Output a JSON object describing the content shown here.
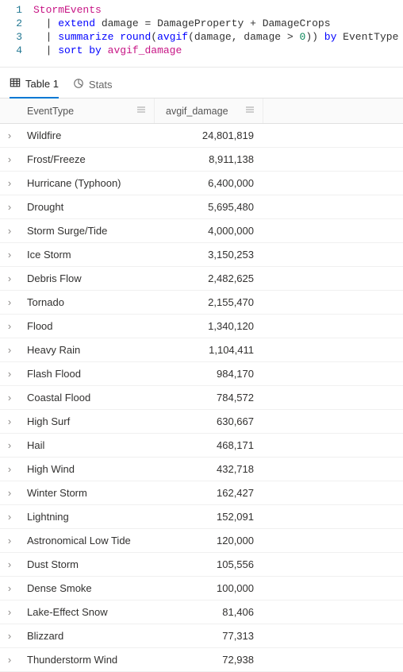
{
  "editor": {
    "lines": [
      {
        "n": "1",
        "tokens": [
          [
            "t-col",
            "StormEvents"
          ]
        ]
      },
      {
        "n": "2",
        "tokens": [
          [
            "t-pipe",
            "  | "
          ],
          [
            "t-kw",
            "extend"
          ],
          [
            "t-id",
            " damage "
          ],
          [
            "t-op",
            "="
          ],
          [
            "t-id",
            " DamageProperty "
          ],
          [
            "t-op",
            "+"
          ],
          [
            "t-id",
            " DamageCrops"
          ]
        ]
      },
      {
        "n": "3",
        "tokens": [
          [
            "t-pipe",
            "  | "
          ],
          [
            "t-kw",
            "summarize"
          ],
          [
            "t-id",
            " "
          ],
          [
            "t-fn",
            "round"
          ],
          [
            "t-id",
            "("
          ],
          [
            "t-fn",
            "avgif"
          ],
          [
            "t-id",
            "(damage, damage "
          ],
          [
            "t-op",
            ">"
          ],
          [
            "t-id",
            " "
          ],
          [
            "t-num",
            "0"
          ],
          [
            "t-id",
            ")) "
          ],
          [
            "t-byk",
            "by"
          ],
          [
            "t-id",
            " EventType"
          ]
        ]
      },
      {
        "n": "4",
        "tokens": [
          [
            "t-pipe",
            "  | "
          ],
          [
            "t-kw",
            "sort"
          ],
          [
            "t-id",
            " "
          ],
          [
            "t-byk",
            "by"
          ],
          [
            "t-id",
            " "
          ],
          [
            "t-col",
            "avgif_damage"
          ]
        ]
      }
    ]
  },
  "tabs": {
    "table_label": "Table 1",
    "stats_label": "Stats"
  },
  "table": {
    "columns": [
      "EventType",
      "avgif_damage"
    ],
    "rows": [
      {
        "EventType": "Wildfire",
        "avgif_damage": "24,801,819"
      },
      {
        "EventType": "Frost/Freeze",
        "avgif_damage": "8,911,138"
      },
      {
        "EventType": "Hurricane (Typhoon)",
        "avgif_damage": "6,400,000"
      },
      {
        "EventType": "Drought",
        "avgif_damage": "5,695,480"
      },
      {
        "EventType": "Storm Surge/Tide",
        "avgif_damage": "4,000,000"
      },
      {
        "EventType": "Ice Storm",
        "avgif_damage": "3,150,253"
      },
      {
        "EventType": "Debris Flow",
        "avgif_damage": "2,482,625"
      },
      {
        "EventType": "Tornado",
        "avgif_damage": "2,155,470"
      },
      {
        "EventType": "Flood",
        "avgif_damage": "1,340,120"
      },
      {
        "EventType": "Heavy Rain",
        "avgif_damage": "1,104,411"
      },
      {
        "EventType": "Flash Flood",
        "avgif_damage": "984,170"
      },
      {
        "EventType": "Coastal Flood",
        "avgif_damage": "784,572"
      },
      {
        "EventType": "High Surf",
        "avgif_damage": "630,667"
      },
      {
        "EventType": "Hail",
        "avgif_damage": "468,171"
      },
      {
        "EventType": "High Wind",
        "avgif_damage": "432,718"
      },
      {
        "EventType": "Winter Storm",
        "avgif_damage": "162,427"
      },
      {
        "EventType": "Lightning",
        "avgif_damage": "152,091"
      },
      {
        "EventType": "Astronomical Low Tide",
        "avgif_damage": "120,000"
      },
      {
        "EventType": "Dust Storm",
        "avgif_damage": "105,556"
      },
      {
        "EventType": "Dense Smoke",
        "avgif_damage": "100,000"
      },
      {
        "EventType": "Lake-Effect Snow",
        "avgif_damage": "81,406"
      },
      {
        "EventType": "Blizzard",
        "avgif_damage": "77,313"
      },
      {
        "EventType": "Thunderstorm Wind",
        "avgif_damage": "72,938"
      }
    ]
  },
  "chart_data": {
    "type": "table",
    "columns": [
      "EventType",
      "avgif_damage"
    ],
    "rows": [
      [
        "Wildfire",
        24801819
      ],
      [
        "Frost/Freeze",
        8911138
      ],
      [
        "Hurricane (Typhoon)",
        6400000
      ],
      [
        "Drought",
        5695480
      ],
      [
        "Storm Surge/Tide",
        4000000
      ],
      [
        "Ice Storm",
        3150253
      ],
      [
        "Debris Flow",
        2482625
      ],
      [
        "Tornado",
        2155470
      ],
      [
        "Flood",
        1340120
      ],
      [
        "Heavy Rain",
        1104411
      ],
      [
        "Flash Flood",
        984170
      ],
      [
        "Coastal Flood",
        784572
      ],
      [
        "High Surf",
        630667
      ],
      [
        "Hail",
        468171
      ],
      [
        "High Wind",
        432718
      ],
      [
        "Winter Storm",
        162427
      ],
      [
        "Lightning",
        152091
      ],
      [
        "Astronomical Low Tide",
        120000
      ],
      [
        "Dust Storm",
        105556
      ],
      [
        "Dense Smoke",
        100000
      ],
      [
        "Lake-Effect Snow",
        81406
      ],
      [
        "Blizzard",
        77313
      ],
      [
        "Thunderstorm Wind",
        72938
      ]
    ]
  }
}
